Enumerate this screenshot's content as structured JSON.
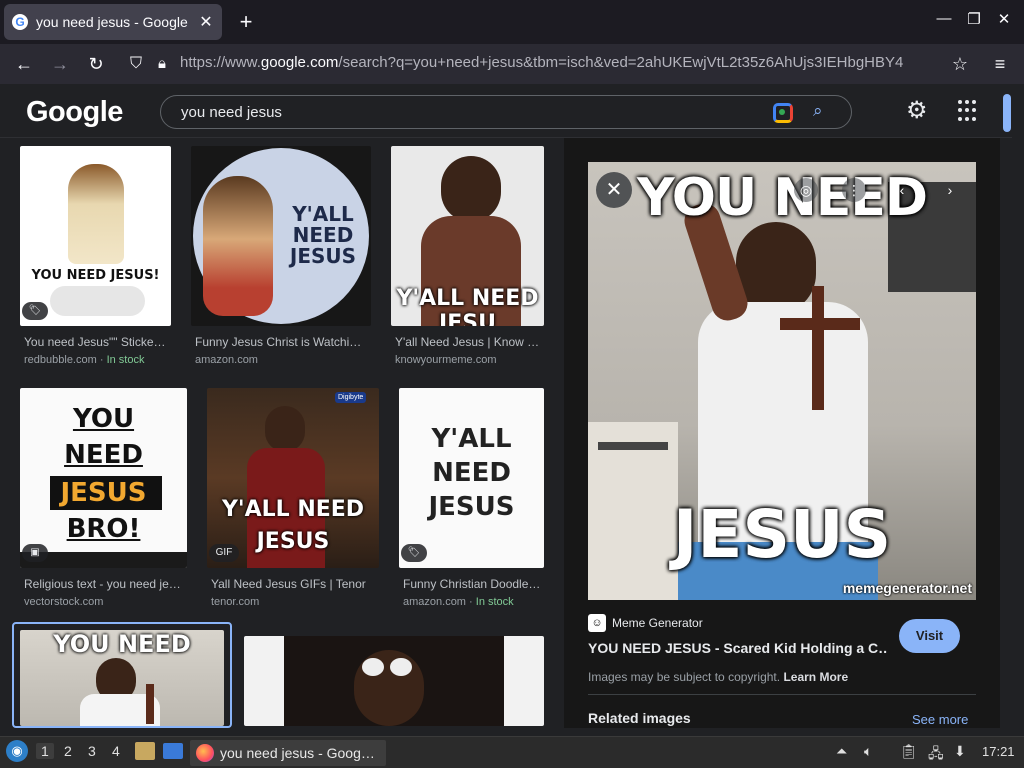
{
  "browser": {
    "tab_title": "you need jesus - Google",
    "tab_favicon": "G",
    "tab_close": "✕",
    "new_tab": "+",
    "url_prefix": "https://www.",
    "url_host": "google.com",
    "url_rest": "/search?q=you+need+jesus&tbm=isch&ved=2ahUKEwjVtL2t35z6AhUjs3IEHbgHBY4"
  },
  "google": {
    "logo": "Google",
    "query": "you need jesus"
  },
  "results": [
    {
      "caption": "You need Jesus\"\" Sticke…",
      "source": "redbubble.com",
      "stock": "In stock",
      "img_text": "YOU NEED JESUS!"
    },
    {
      "caption": "Funny Jesus Christ is Watchi…",
      "source": "amazon.com",
      "stock": "",
      "img_text": "Y'ALL NEED JESUS"
    },
    {
      "caption": "Y'all Need Jesus | Know …",
      "source": "knowyourmeme.com",
      "stock": "",
      "img_text": "Y'ALL NEED JESU"
    },
    {
      "caption": "Religious text - you need je…",
      "source": "vectorstock.com",
      "stock": "",
      "img_text_1": "YOU",
      "img_text_2": "NEED",
      "img_text_3": "JESUS",
      "img_text_4": "BRO!"
    },
    {
      "caption": "Yall Need Jesus GIFs | Tenor",
      "source": "tenor.com",
      "stock": "",
      "img_text": "Y'ALL NEED JESUS",
      "badge": "GIF",
      "corner_badge": "Digibyte"
    },
    {
      "caption": "Funny Christian Doodle…",
      "source": "amazon.com",
      "stock": "In stock",
      "img_text_1": "Y'ALL",
      "img_text_2": "NEED",
      "img_text_3": "JESUS"
    },
    {
      "img_text": "YOU NEED"
    }
  ],
  "preview": {
    "top_text": "YOU NEED",
    "bottom_text": "JESUS",
    "watermark": "memegenerator.net",
    "site": "Meme Generator",
    "title": "YOU NEED JESUS - Scared Kid Holding a C…",
    "visit": "Visit",
    "copyright": "Images may be subject to copyright.",
    "learn_more": "Learn More",
    "related": "Related images",
    "see_more": "See more"
  },
  "taskbar": {
    "workspaces": [
      "1",
      "2",
      "3",
      "4"
    ],
    "task_title": "you need jesus - Goog…",
    "clock": "17:21"
  },
  "colors": {
    "accent": "#8ab4f8",
    "background": "#202124",
    "in_stock": "#81c995"
  }
}
